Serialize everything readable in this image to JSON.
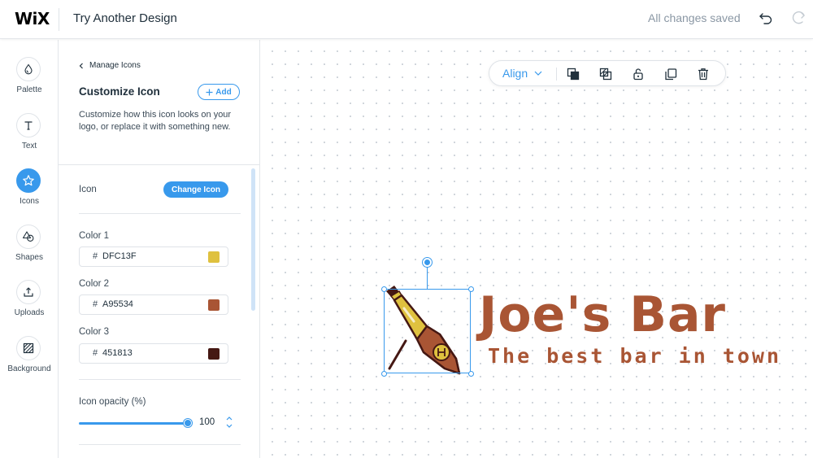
{
  "app": {
    "logo": "WiX",
    "design_title": "Try Another Design",
    "save_status": "All changes saved"
  },
  "rail": {
    "items": [
      {
        "label": "Palette",
        "icon": "palette-icon"
      },
      {
        "label": "Text",
        "icon": "text-icon"
      },
      {
        "label": "Icons",
        "icon": "star-icon",
        "active": true
      },
      {
        "label": "Shapes",
        "icon": "shapes-icon"
      },
      {
        "label": "Uploads",
        "icon": "upload-icon"
      },
      {
        "label": "Background",
        "icon": "background-icon"
      }
    ]
  },
  "panel": {
    "back_label": "Manage Icons",
    "title": "Customize Icon",
    "add_label": "Add",
    "description": "Customize how this icon looks on your logo, or replace it with something new.",
    "icon_label": "Icon",
    "change_icon_label": "Change Icon",
    "colors": [
      {
        "label": "Color 1",
        "hex": "DFC13F",
        "swatch": "#DFC13F"
      },
      {
        "label": "Color 2",
        "hex": "A95534",
        "swatch": "#A95534"
      },
      {
        "label": "Color 3",
        "hex": "451813",
        "swatch": "#451813"
      }
    ],
    "opacity_label": "Icon opacity (%)",
    "opacity_value": "100"
  },
  "toolbar": {
    "align_label": "Align",
    "icons": [
      "bring-forward-icon",
      "send-backward-icon",
      "unlock-icon",
      "duplicate-icon",
      "delete-icon"
    ]
  },
  "logo_design": {
    "name": "Joe's Bar",
    "tagline": "The best bar in town",
    "accent_color": "#A95534"
  },
  "theme": {
    "accent": "#3899EC"
  }
}
